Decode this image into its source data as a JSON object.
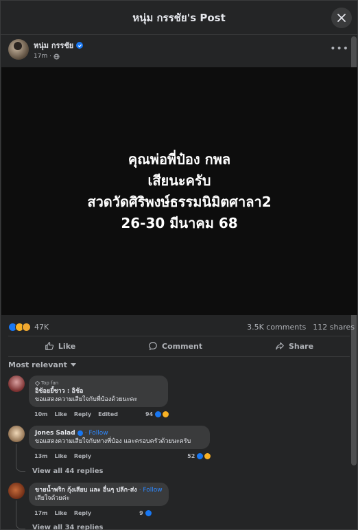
{
  "dialog": {
    "title": "หนุ่ม กรรชัย's Post",
    "close_icon": "close-icon"
  },
  "post": {
    "author": "หนุ่ม กรรชัย",
    "time": "17m ·",
    "image_text": [
      "คุณพ่อพี่ป๋อง กพล",
      "เสียนะครับ",
      "สวดวัดศิริพงษ์ธรรมนิมิตศาลา2",
      "26-30 มีนาคม 68"
    ],
    "reaction_count": "47K",
    "comments_count": "3.5K comments",
    "shares_count": "112 shares"
  },
  "actions": {
    "like": "Like",
    "comment": "Comment",
    "share": "Share"
  },
  "sort": {
    "label": "Most relevant"
  },
  "comments": [
    {
      "badge": "Top fan",
      "name": "อิช้อยยี้ชาว : อิช้อ",
      "text": "ขอแสดงความเสียใจกับพี่ป๋องด้วยนะคะ",
      "time": "10m",
      "like": "Like",
      "reply": "Reply",
      "edited": "Edited",
      "reacts": "94"
    },
    {
      "name": "Jones Salad",
      "follow": "· Follow",
      "text": "ขอแสดงความเสียใจกับทางพี่ป๋อง และครอบครัวด้วยนะครับ",
      "time": "13m",
      "like": "Like",
      "reply": "Reply",
      "reacts": "52",
      "replies": "View all 44 replies"
    },
    {
      "name": "ขายน้ำพริก กุ้งเสียบ และ อื่นๆ ปลีก-ส่ง",
      "follow": "· Follow",
      "text": "เสียใจด้วยค่ะ",
      "time": "17m",
      "like": "Like",
      "reply": "Reply",
      "reacts": "9",
      "replies": "View all 34 replies"
    }
  ],
  "colors": {
    "accent": "#1877f2",
    "background": "#242526",
    "bubble": "#3a3b3c"
  }
}
